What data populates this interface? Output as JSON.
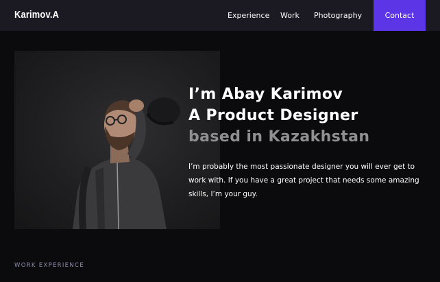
{
  "header": {
    "logo": "Karimov.A",
    "nav": {
      "experience": "Experience",
      "work": "Work",
      "photography": "Photography"
    },
    "contact_label": "Contact"
  },
  "hero": {
    "line1": "I’m Abay Karimov",
    "line2": "A Product Designer",
    "line3": "based in Kazakhstan",
    "bio": "I’m probably the most passionate designer you will ever get to work with. If you have a great project that needs some amazing skills, I’m your guy."
  },
  "section": {
    "work_experience_label": "WORK EXPERIENCE"
  },
  "colors": {
    "background": "#0b0b0e",
    "header": "#1b1922",
    "accent": "#5b35e6",
    "muted_heading": "#8f8f8f"
  }
}
